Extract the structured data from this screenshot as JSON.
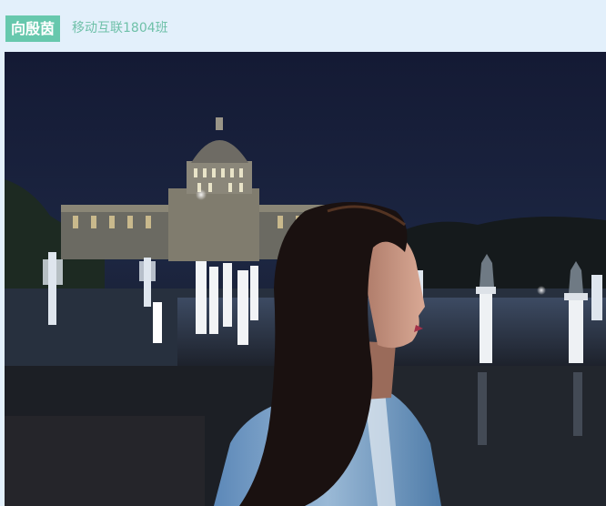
{
  "header": {
    "name": "向殷茵",
    "class_name": "移动互联1804班"
  },
  "photo": {
    "description_icon": "night-photo-portrait",
    "colors": {
      "sky_top": "#151a33",
      "sky_bottom": "#1d2740",
      "accent": "#67c8ad"
    }
  }
}
